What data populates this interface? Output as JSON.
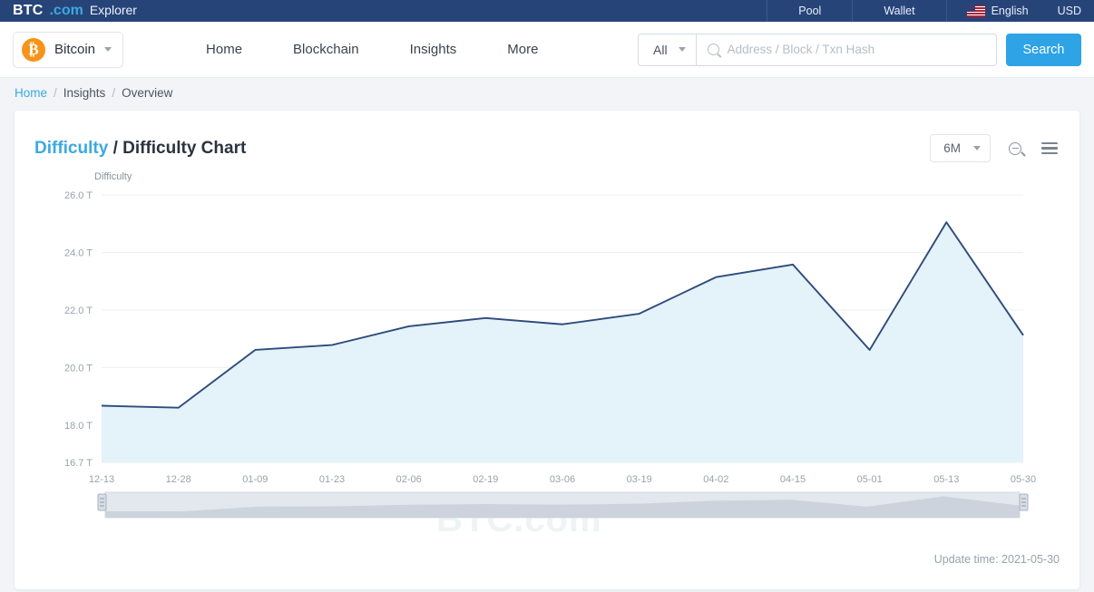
{
  "topbar": {
    "brand_btc": "BTC",
    "brand_com": ".com",
    "brand_explorer": "Explorer",
    "links": [
      {
        "label": "Pool",
        "name": "pool"
      },
      {
        "label": "Wallet",
        "name": "wallet"
      }
    ],
    "language": "English",
    "language_icon": "us-flag-icon",
    "currency": "USD",
    "background_color": "#274479"
  },
  "navbar": {
    "coin": "Bitcoin",
    "coin_symbol": "₿",
    "coin_color": "#f7931a",
    "links": [
      {
        "label": "Home",
        "name": "home"
      },
      {
        "label": "Blockchain",
        "name": "blockchain"
      },
      {
        "label": "Insights",
        "name": "insights"
      },
      {
        "label": "More",
        "name": "more"
      }
    ],
    "search": {
      "scope": "All",
      "placeholder": "Address / Block / Txn Hash",
      "value": "",
      "button_label": "Search",
      "button_color": "#2ea3e6"
    }
  },
  "breadcrumb": {
    "home": "Home",
    "sep1": "/",
    "insights": "Insights",
    "sep2": "/",
    "overview": "Overview"
  },
  "card": {
    "title_accent": "Difficulty",
    "title_sep": "/",
    "title_rest": "Difficulty Chart",
    "range": "6M",
    "zoom_icon": "zoom-out-icon",
    "menu_icon": "hamburger-menu-icon",
    "watermark": "BTC.com",
    "update_time": "Update time: 2021-05-30"
  },
  "chart_data": {
    "type": "area",
    "title": "Difficulty Chart",
    "xlabel": "",
    "ylabel": "Difficulty",
    "ylim": [
      16.7,
      26.0
    ],
    "yticks": [
      "16.7 T",
      "18.0 T",
      "20.0 T",
      "22.0 T",
      "24.0 T",
      "26.0 T"
    ],
    "ytick_values": [
      16.7,
      18.0,
      20.0,
      22.0,
      24.0,
      26.0
    ],
    "grid": true,
    "legend": "none",
    "line_color": "#2e4b7c",
    "fill_color": "#e4f2f9",
    "categories": [
      "12-13",
      "12-28",
      "01-09",
      "01-23",
      "02-06",
      "02-19",
      "03-06",
      "03-19",
      "04-02",
      "04-15",
      "05-01",
      "05-13",
      "05-30"
    ],
    "values": [
      18.67,
      18.6,
      20.61,
      20.78,
      21.43,
      21.72,
      21.5,
      21.87,
      23.14,
      23.58,
      20.61,
      25.05,
      21.12
    ],
    "unit": "T",
    "navigator": {
      "visible": true,
      "handle_left": "navigator-handle-left",
      "handle_right": "navigator-handle-right"
    }
  }
}
